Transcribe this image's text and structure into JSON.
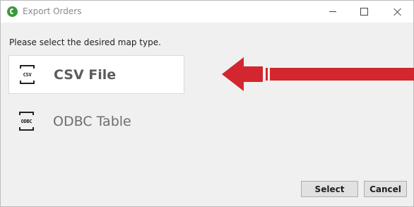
{
  "window": {
    "title": "Export Orders",
    "app_icon": "app-logo-icon",
    "controls": [
      "minimize-icon",
      "maximize-icon",
      "close-icon"
    ]
  },
  "prompt": "Please select the desired map type.",
  "options": [
    {
      "icon_text": "CSV",
      "label": "CSV File",
      "selected": true
    },
    {
      "icon_text": "ODBC",
      "label": "ODBC Table",
      "selected": false
    }
  ],
  "annotation": {
    "type": "arrow-left",
    "color": "#d3262e"
  },
  "buttons": {
    "select": "Select",
    "cancel": "Cancel"
  },
  "colors": {
    "accent_arrow": "#d3262e",
    "app_icon": "#3a9a3a",
    "window_bg": "#f0f0f0"
  }
}
